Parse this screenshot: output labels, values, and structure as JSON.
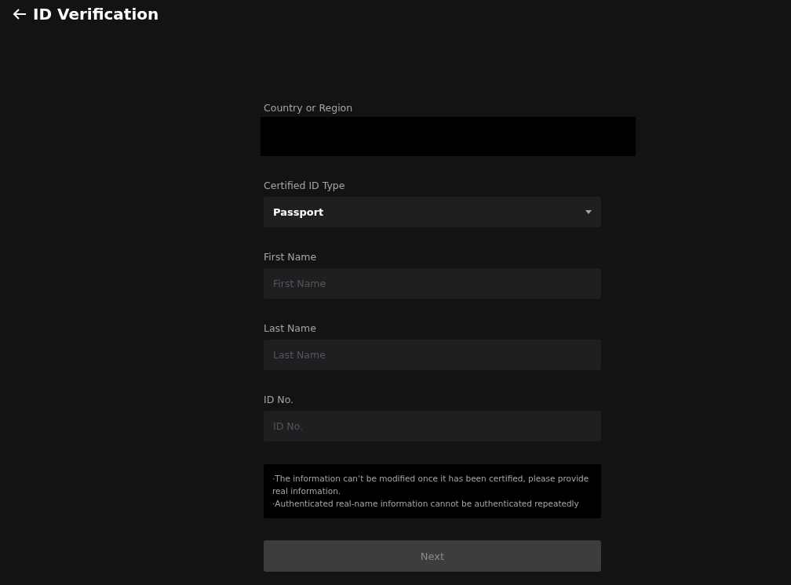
{
  "header": {
    "title": "ID Verification"
  },
  "fields": [
    {
      "kind": "blank",
      "label": "Country or Region"
    },
    {
      "kind": "select",
      "label": "Certified ID Type",
      "value": "Passport"
    },
    {
      "kind": "text",
      "label": "First Name",
      "placeholder": "First Name"
    },
    {
      "kind": "text",
      "label": "Last Name",
      "placeholder": "Last Name"
    },
    {
      "kind": "text",
      "label": "ID No.",
      "placeholder": "ID No."
    }
  ],
  "notice": [
    "·The information can‘t be modified once it has been certified, please provide real information.",
    "·Authenticated real-name information cannot be authenticated repeatedly"
  ],
  "next_button": {
    "label": "Next",
    "disabled": true
  }
}
